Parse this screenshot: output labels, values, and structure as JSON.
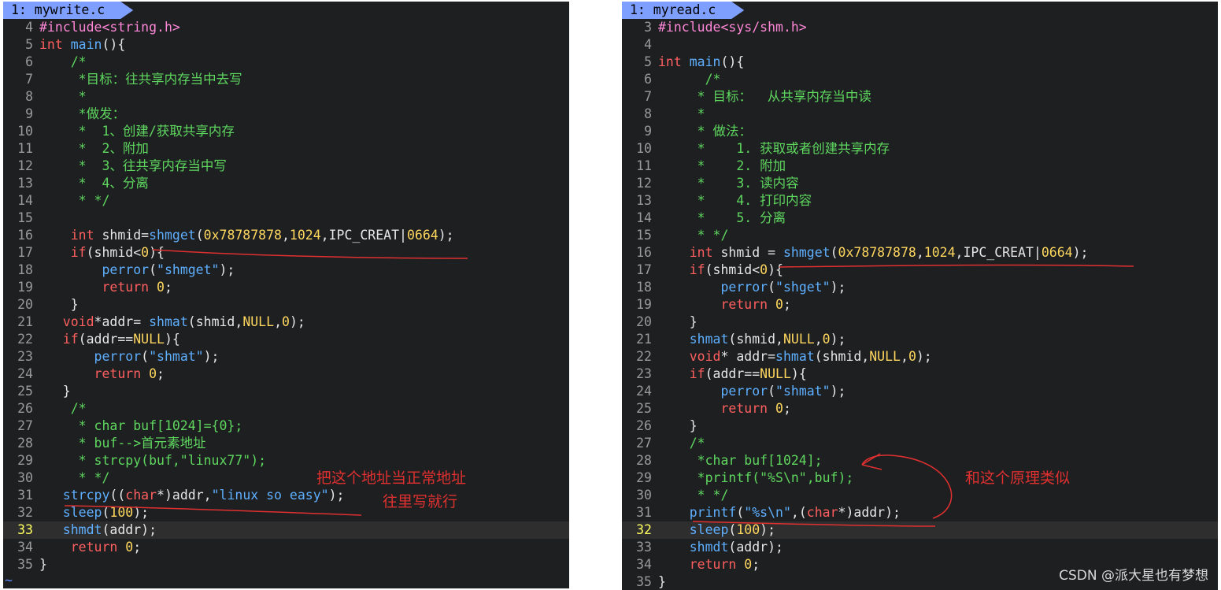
{
  "left": {
    "tab_label": "1: mywrite.c",
    "lines": [
      {
        "n": "4",
        "segs": [
          [
            "p",
            "#include<string.h>"
          ]
        ]
      },
      {
        "n": "5",
        "segs": [
          [
            "t",
            "int "
          ],
          [
            "f",
            "main"
          ],
          [
            "",
            "(){"
          ]
        ]
      },
      {
        "n": "6",
        "segs": [
          [
            "c",
            "    /*"
          ]
        ]
      },
      {
        "n": "7",
        "segs": [
          [
            "c",
            "     *目标：往共享内存当中去写"
          ]
        ]
      },
      {
        "n": "8",
        "segs": [
          [
            "c",
            "     *"
          ]
        ]
      },
      {
        "n": "9",
        "segs": [
          [
            "c",
            "     *做发："
          ]
        ]
      },
      {
        "n": "10",
        "segs": [
          [
            "c",
            "     *  1、创建/获取共享内存"
          ]
        ]
      },
      {
        "n": "11",
        "segs": [
          [
            "c",
            "     *  2、附加"
          ]
        ]
      },
      {
        "n": "12",
        "segs": [
          [
            "c",
            "     *  3、往共享内存当中写"
          ]
        ]
      },
      {
        "n": "13",
        "segs": [
          [
            "c",
            "     *  4、分离"
          ]
        ]
      },
      {
        "n": "14",
        "segs": [
          [
            "c",
            "     * */"
          ]
        ]
      },
      {
        "n": "15",
        "segs": [
          [
            "",
            ""
          ]
        ]
      },
      {
        "n": "16",
        "segs": [
          [
            "t",
            "    int "
          ],
          [
            "",
            "shmid="
          ],
          [
            "f",
            "shmget"
          ],
          [
            "",
            "("
          ],
          [
            "n",
            "0x78787878"
          ],
          [
            "",
            ","
          ],
          [
            "n",
            "1024"
          ],
          [
            "",
            ",IPC_CREAT|"
          ],
          [
            "n",
            "0664"
          ],
          [
            "",
            ");"
          ]
        ]
      },
      {
        "n": "17",
        "segs": [
          [
            "k",
            "    if"
          ],
          [
            "",
            "(shmid<"
          ],
          [
            "n",
            "0"
          ],
          [
            "",
            "){"
          ]
        ]
      },
      {
        "n": "18",
        "segs": [
          [
            "f",
            "        perror"
          ],
          [
            "",
            "("
          ],
          [
            "s",
            "\"shmget\""
          ],
          [
            "",
            ");"
          ]
        ]
      },
      {
        "n": "19",
        "segs": [
          [
            "k",
            "        return "
          ],
          [
            "n",
            "0"
          ],
          [
            "",
            ";"
          ]
        ]
      },
      {
        "n": "20",
        "segs": [
          [
            "",
            "    }"
          ]
        ]
      },
      {
        "n": "21",
        "segs": [
          [
            "t",
            "   void"
          ],
          [
            "",
            "*addr= "
          ],
          [
            "f",
            "shmat"
          ],
          [
            "",
            "(shmid,"
          ],
          [
            "n",
            "NULL"
          ],
          [
            "",
            ","
          ],
          [
            "n",
            "0"
          ],
          [
            "",
            ");"
          ]
        ]
      },
      {
        "n": "22",
        "segs": [
          [
            "k",
            "   if"
          ],
          [
            "",
            "(addr=="
          ],
          [
            "n",
            "NULL"
          ],
          [
            "",
            "){"
          ]
        ]
      },
      {
        "n": "23",
        "segs": [
          [
            "f",
            "       perror"
          ],
          [
            "",
            "("
          ],
          [
            "s",
            "\"shmat\""
          ],
          [
            "",
            ");"
          ]
        ]
      },
      {
        "n": "24",
        "segs": [
          [
            "k",
            "       return "
          ],
          [
            "n",
            "0"
          ],
          [
            "",
            ";"
          ]
        ]
      },
      {
        "n": "25",
        "segs": [
          [
            "",
            "   }"
          ]
        ]
      },
      {
        "n": "26",
        "segs": [
          [
            "c",
            "    /*"
          ]
        ]
      },
      {
        "n": "27",
        "segs": [
          [
            "c",
            "     * char buf[1024]={0};"
          ]
        ]
      },
      {
        "n": "28",
        "segs": [
          [
            "c",
            "     * buf-->首元素地址"
          ]
        ]
      },
      {
        "n": "29",
        "segs": [
          [
            "c",
            "     * strcpy(buf,\"linux77\");"
          ]
        ]
      },
      {
        "n": "30",
        "segs": [
          [
            "c",
            "     * */"
          ]
        ]
      },
      {
        "n": "31",
        "segs": [
          [
            "f",
            "   strcpy"
          ],
          [
            "",
            "(("
          ],
          [
            "t",
            "char"
          ],
          [
            "",
            "*)addr,"
          ],
          [
            "s",
            "\"linux so easy\""
          ],
          [
            "",
            ");"
          ]
        ]
      },
      {
        "n": "32",
        "segs": [
          [
            "f",
            "   sleep"
          ],
          [
            "",
            "("
          ],
          [
            "n",
            "100"
          ],
          [
            "",
            ");"
          ]
        ]
      },
      {
        "n": "33",
        "segs": [
          [
            "f",
            "   shmdt"
          ],
          [
            "",
            "(addr);"
          ]
        ],
        "current": true
      },
      {
        "n": "34",
        "segs": [
          [
            "k",
            "    return "
          ],
          [
            "n",
            "0"
          ],
          [
            "",
            ";"
          ]
        ]
      },
      {
        "n": "35",
        "segs": [
          [
            "",
            "}"
          ]
        ]
      }
    ],
    "end_marker": "~",
    "note_1": "把这个地址当正常地址",
    "note_2": "往里写就行"
  },
  "right": {
    "tab_label": "1: myread.c",
    "lines": [
      {
        "n": "3",
        "segs": [
          [
            "p",
            "#include<sys/shm.h>"
          ]
        ]
      },
      {
        "n": "4",
        "segs": [
          [
            "",
            ""
          ]
        ]
      },
      {
        "n": "5",
        "segs": [
          [
            "t",
            "int "
          ],
          [
            "f",
            "main"
          ],
          [
            "",
            "(){"
          ]
        ]
      },
      {
        "n": "6",
        "segs": [
          [
            "c",
            "      /*"
          ]
        ]
      },
      {
        "n": "7",
        "segs": [
          [
            "c",
            "     * 目标：  从共享内存当中读"
          ]
        ]
      },
      {
        "n": "8",
        "segs": [
          [
            "c",
            "     *"
          ]
        ]
      },
      {
        "n": "9",
        "segs": [
          [
            "c",
            "     * 做法："
          ]
        ]
      },
      {
        "n": "10",
        "segs": [
          [
            "c",
            "     *    1. 获取或者创建共享内存"
          ]
        ]
      },
      {
        "n": "11",
        "segs": [
          [
            "c",
            "     *    2. 附加"
          ]
        ]
      },
      {
        "n": "12",
        "segs": [
          [
            "c",
            "     *    3. 读内容"
          ]
        ]
      },
      {
        "n": "13",
        "segs": [
          [
            "c",
            "     *    4. 打印内容"
          ]
        ]
      },
      {
        "n": "14",
        "segs": [
          [
            "c",
            "     *    5. 分离"
          ]
        ]
      },
      {
        "n": "15",
        "segs": [
          [
            "c",
            "     * */"
          ]
        ]
      },
      {
        "n": "16",
        "segs": [
          [
            "t",
            "    int "
          ],
          [
            "",
            "shmid = "
          ],
          [
            "f",
            "shmget"
          ],
          [
            "",
            "("
          ],
          [
            "n",
            "0x78787878"
          ],
          [
            "",
            ","
          ],
          [
            "n",
            "1024"
          ],
          [
            "",
            ",IPC_CREAT|"
          ],
          [
            "n",
            "0664"
          ],
          [
            "",
            ");"
          ]
        ]
      },
      {
        "n": "17",
        "segs": [
          [
            "k",
            "    if"
          ],
          [
            "",
            "(shmid<"
          ],
          [
            "n",
            "0"
          ],
          [
            "",
            "){"
          ]
        ]
      },
      {
        "n": "18",
        "segs": [
          [
            "f",
            "        perror"
          ],
          [
            "",
            "("
          ],
          [
            "s",
            "\"shget\""
          ],
          [
            "",
            ");"
          ]
        ]
      },
      {
        "n": "19",
        "segs": [
          [
            "k",
            "        return "
          ],
          [
            "n",
            "0"
          ],
          [
            "",
            ";"
          ]
        ]
      },
      {
        "n": "20",
        "segs": [
          [
            "",
            "    }"
          ]
        ]
      },
      {
        "n": "21",
        "segs": [
          [
            "f",
            "    shmat"
          ],
          [
            "",
            "(shmid,"
          ],
          [
            "n",
            "NULL"
          ],
          [
            "",
            ","
          ],
          [
            "n",
            "0"
          ],
          [
            "",
            ");"
          ]
        ]
      },
      {
        "n": "22",
        "segs": [
          [
            "t",
            "    void"
          ],
          [
            "",
            "* addr="
          ],
          [
            "f",
            "shmat"
          ],
          [
            "",
            "(shmid,"
          ],
          [
            "n",
            "NULL"
          ],
          [
            "",
            ","
          ],
          [
            "n",
            "0"
          ],
          [
            "",
            ");"
          ]
        ]
      },
      {
        "n": "23",
        "segs": [
          [
            "k",
            "    if"
          ],
          [
            "",
            "(addr=="
          ],
          [
            "n",
            "NULL"
          ],
          [
            "",
            "){"
          ]
        ]
      },
      {
        "n": "24",
        "segs": [
          [
            "f",
            "        perror"
          ],
          [
            "",
            "("
          ],
          [
            "s",
            "\"shmat\""
          ],
          [
            "",
            ");"
          ]
        ]
      },
      {
        "n": "25",
        "segs": [
          [
            "k",
            "        return "
          ],
          [
            "n",
            "0"
          ],
          [
            "",
            ";"
          ]
        ]
      },
      {
        "n": "26",
        "segs": [
          [
            "",
            "    }"
          ]
        ]
      },
      {
        "n": "27",
        "segs": [
          [
            "c",
            "    /*"
          ]
        ]
      },
      {
        "n": "28",
        "segs": [
          [
            "c",
            "     *char buf[1024];"
          ]
        ]
      },
      {
        "n": "29",
        "segs": [
          [
            "c",
            "     *printf(\"%S\\n\",buf);"
          ]
        ]
      },
      {
        "n": "30",
        "segs": [
          [
            "c",
            "     * */"
          ]
        ]
      },
      {
        "n": "31",
        "segs": [
          [
            "f",
            "    printf"
          ],
          [
            "",
            "("
          ],
          [
            "s",
            "\"%s\\n\""
          ],
          [
            "",
            ",("
          ],
          [
            "t",
            "char"
          ],
          [
            "",
            "*)addr);"
          ]
        ]
      },
      {
        "n": "32",
        "segs": [
          [
            "f",
            "    sleep"
          ],
          [
            "",
            "("
          ],
          [
            "n",
            "100"
          ],
          [
            "",
            ");"
          ]
        ],
        "current": true
      },
      {
        "n": "33",
        "segs": [
          [
            "f",
            "    shmdt"
          ],
          [
            "",
            "(addr);"
          ]
        ]
      },
      {
        "n": "34",
        "segs": [
          [
            "k",
            "    return "
          ],
          [
            "n",
            "0"
          ],
          [
            "",
            ";"
          ]
        ]
      },
      {
        "n": "35",
        "segs": [
          [
            "",
            "}"
          ]
        ]
      }
    ],
    "note_1": "和这个原理类似"
  },
  "watermark": "CSDN @派大星也有梦想",
  "colors": {
    "annotation": "#e03030",
    "tab": "#7f9fff",
    "editor_bg": "#1d1f21"
  }
}
